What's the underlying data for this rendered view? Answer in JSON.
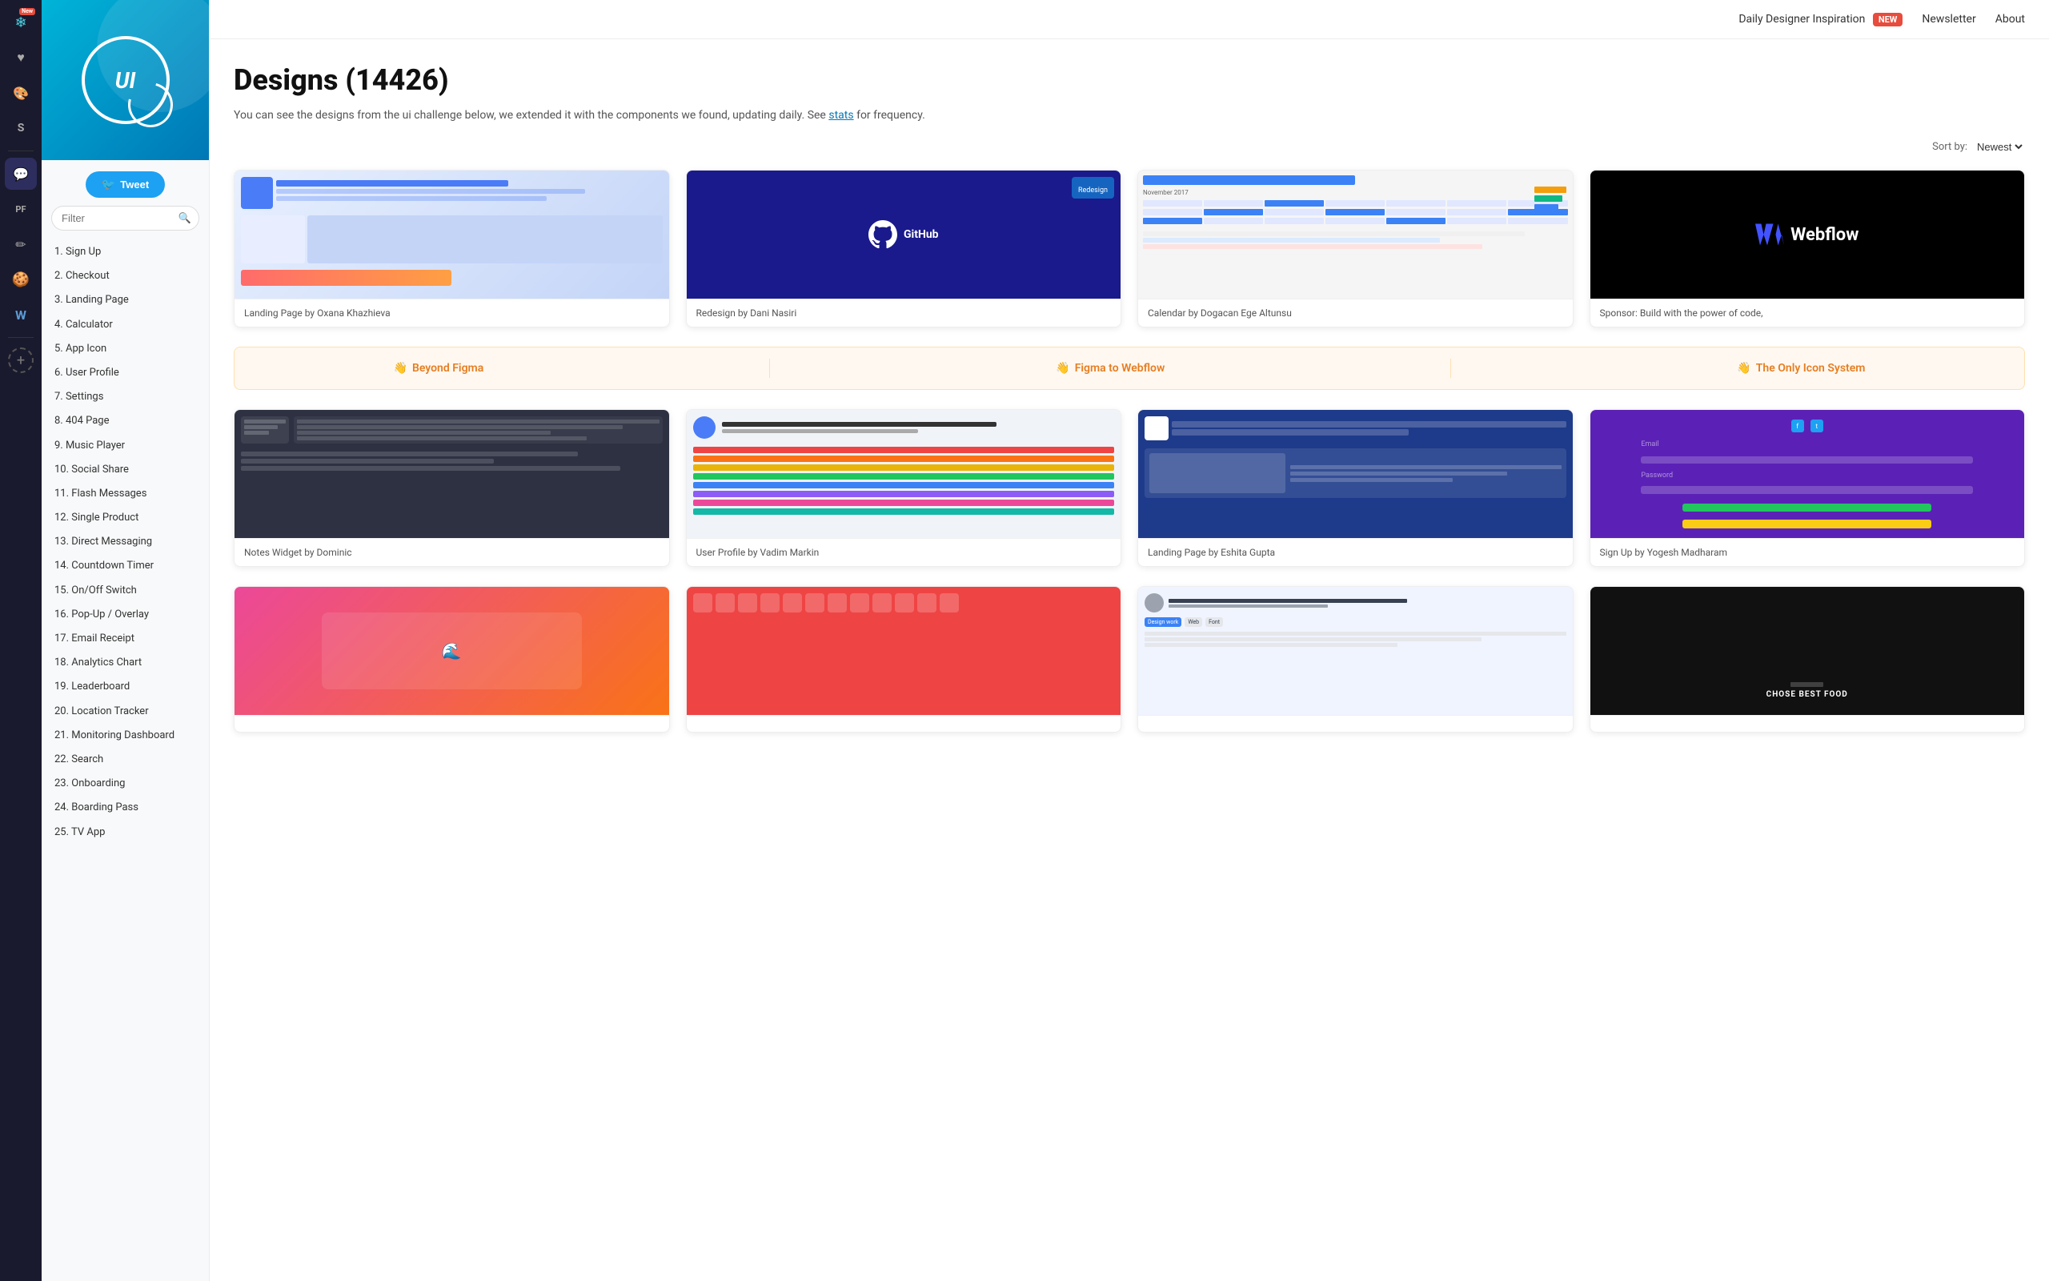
{
  "iconBar": {
    "items": [
      {
        "name": "new-icon",
        "symbol": "❄",
        "badge": "New",
        "active": false
      },
      {
        "name": "heart-icon",
        "symbol": "♥",
        "active": false
      },
      {
        "name": "palette-icon",
        "symbol": "🎨",
        "active": false
      },
      {
        "name": "sketch-icon",
        "symbol": "S",
        "active": false
      },
      {
        "name": "chat-icon",
        "symbol": "💬",
        "active": true
      },
      {
        "name": "pf-icon",
        "symbol": "PF",
        "active": false
      },
      {
        "name": "pen-icon",
        "symbol": "✏",
        "active": false
      },
      {
        "name": "cookie-icon",
        "symbol": "🍪",
        "active": false
      },
      {
        "name": "w-icon",
        "symbol": "W",
        "active": false
      }
    ]
  },
  "sidebar": {
    "logoText": "UI",
    "tweetButton": "Tweet",
    "filterPlaceholder": "Filter",
    "navItems": [
      {
        "id": 1,
        "label": "1. Sign Up"
      },
      {
        "id": 2,
        "label": "2. Checkout"
      },
      {
        "id": 3,
        "label": "3. Landing Page"
      },
      {
        "id": 4,
        "label": "4. Calculator"
      },
      {
        "id": 5,
        "label": "5. App Icon"
      },
      {
        "id": 6,
        "label": "6. User Profile"
      },
      {
        "id": 7,
        "label": "7. Settings"
      },
      {
        "id": 8,
        "label": "8. 404 Page"
      },
      {
        "id": 9,
        "label": "9. Music Player"
      },
      {
        "id": 10,
        "label": "10. Social Share"
      },
      {
        "id": 11,
        "label": "11. Flash Messages"
      },
      {
        "id": 12,
        "label": "12. Single Product"
      },
      {
        "id": 13,
        "label": "13. Direct Messaging"
      },
      {
        "id": 14,
        "label": "14. Countdown Timer"
      },
      {
        "id": 15,
        "label": "15. On/Off Switch"
      },
      {
        "id": 16,
        "label": "16. Pop-Up / Overlay"
      },
      {
        "id": 17,
        "label": "17. Email Receipt"
      },
      {
        "id": 18,
        "label": "18. Analytics Chart"
      },
      {
        "id": 19,
        "label": "19. Leaderboard"
      },
      {
        "id": 20,
        "label": "20. Location Tracker"
      },
      {
        "id": 21,
        "label": "21. Monitoring Dashboard"
      },
      {
        "id": 22,
        "label": "22. Search"
      },
      {
        "id": 23,
        "label": "23. Onboarding"
      },
      {
        "id": 24,
        "label": "24. Boarding Pass"
      },
      {
        "id": 25,
        "label": "25. TV App"
      }
    ]
  },
  "topNav": {
    "dailyDesigner": "Daily Designer Inspiration",
    "newBadge": "NEW",
    "newsletter": "Newsletter",
    "about": "About"
  },
  "main": {
    "title": "Designs (14426)",
    "description": "You can see the designs from the ui challenge below, we extended it with the components we found, updating daily. See",
    "statsLink": "stats",
    "descriptionSuffix": " for frequency.",
    "sortLabel": "Sort by:",
    "sortValue": "Newest"
  },
  "promoBar": {
    "items": [
      {
        "emoji": "👋",
        "label": "Beyond Figma"
      },
      {
        "emoji": "👋",
        "label": "Figma to Webflow"
      },
      {
        "emoji": "👋",
        "label": "The Only Icon System"
      }
    ]
  },
  "designCards": {
    "row1": [
      {
        "caption": "Landing Page by Oxana Khazhieva",
        "type": "landing"
      },
      {
        "caption": "Redesign by Dani Nasiri",
        "type": "github"
      },
      {
        "caption": "Calendar by Dogacan Ege Altunsu",
        "type": "calendar"
      },
      {
        "caption": "Sponsor: Build with the power of code,",
        "type": "webflow"
      }
    ],
    "row2": [
      {
        "caption": "Notes Widget by Dominic",
        "type": "notes"
      },
      {
        "caption": "User Profile by Vadim Markin",
        "type": "userprofile"
      },
      {
        "caption": "Landing Page by Eshita Gupta",
        "type": "landing2"
      },
      {
        "caption": "Sign Up by Yogesh Madharam",
        "type": "signup"
      }
    ],
    "row3": [
      {
        "caption": "",
        "type": "pink"
      },
      {
        "caption": "",
        "type": "redicons"
      },
      {
        "caption": "",
        "type": "lightprofile"
      },
      {
        "caption": "",
        "type": "darkfood"
      }
    ]
  }
}
